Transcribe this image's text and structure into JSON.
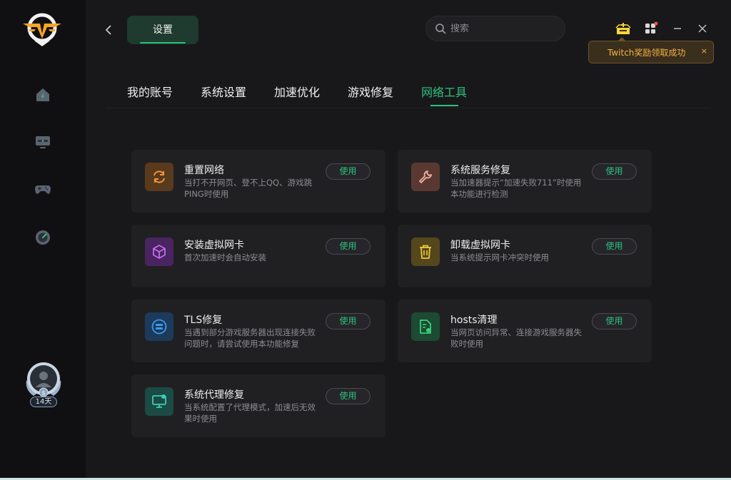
{
  "app": {
    "page_tab_label": "设置",
    "search_placeholder": "搜索",
    "toast_text": "Twitch奖励领取成功",
    "toast_close": "×",
    "vip_days": "14天"
  },
  "tabs": [
    {
      "label": "我的账号"
    },
    {
      "label": "系统设置"
    },
    {
      "label": "加速优化"
    },
    {
      "label": "游戏修复"
    },
    {
      "label": "网络工具",
      "active": true
    }
  ],
  "tools": [
    {
      "title": "重置网络",
      "desc": "当打不开网页、登不上QQ、游戏跳PING时使用",
      "button": "使用",
      "icon": "refresh-icon",
      "icon_bg": "#5a3a1c",
      "icon_color": "#f0963a"
    },
    {
      "title": "系统服务修复",
      "desc": "当加速器提示“加速失败711”时使用本功能进行检测",
      "button": "使用",
      "icon": "wrench-icon",
      "icon_bg": "#5a3832",
      "icon_color": "#f09a8a"
    },
    {
      "title": "安装虚拟网卡",
      "desc": "首次加速时会自动安装",
      "button": "使用",
      "icon": "cube-icon",
      "icon_bg": "#4a2460",
      "icon_color": "#c46bf0"
    },
    {
      "title": "卸载虚拟网卡",
      "desc": "当系统提示网卡冲突时使用",
      "button": "使用",
      "icon": "trash-icon",
      "icon_bg": "#54471c",
      "icon_color": "#f0c93a"
    },
    {
      "title": "TLS修复",
      "desc": "当遇到部分游戏服务器出现连接失败问题时，请尝试使用本功能修复",
      "button": "使用",
      "icon": "tls-icon",
      "icon_bg": "#1c3a5a",
      "icon_color": "#3a9af0"
    },
    {
      "title": "hosts清理",
      "desc": "当网页访问异常、连接游戏服务器失败时使用",
      "button": "使用",
      "icon": "document-clean-icon",
      "icon_bg": "#1c4a32",
      "icon_color": "#3ad07a"
    },
    {
      "title": "系统代理修复",
      "desc": "当系统配置了代理模式，加速后无效果时使用",
      "button": "使用",
      "icon": "monitor-icon",
      "icon_bg": "#1c4a44",
      "icon_color": "#3ad0b4"
    }
  ],
  "colors": {
    "accent": "#2ec27e",
    "toast_text": "#f5b444"
  }
}
